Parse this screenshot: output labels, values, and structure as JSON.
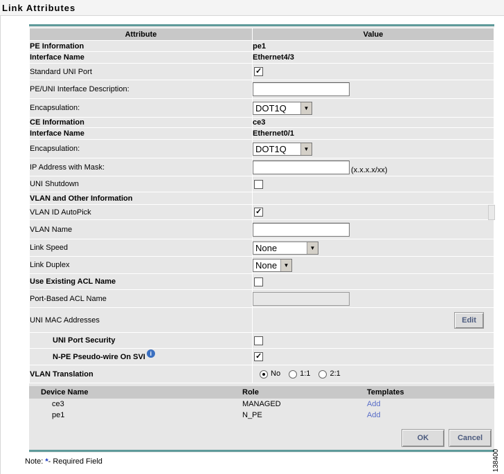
{
  "page": {
    "title": "Link Attributes"
  },
  "table": {
    "col_attribute": "Attribute",
    "col_value": "Value"
  },
  "pe": {
    "section": "PE Information",
    "value": "pe1",
    "interface_name_label": "Interface Name",
    "interface_name": "Ethernet4/3",
    "std_uni_label": "Standard UNI Port",
    "std_uni_checked": true,
    "desc_label": "PE/UNI Interface Description:",
    "desc_value": "",
    "encap_label": "Encapsulation:",
    "encap_value": "DOT1Q"
  },
  "ce": {
    "section": "CE Information",
    "value": "ce3",
    "interface_name_label": "Interface Name",
    "interface_name": "Ethernet0/1",
    "encap_label": "Encapsulation:",
    "encap_value": "DOT1Q",
    "ip_label": "IP Address with Mask:",
    "ip_value": "",
    "ip_hint": "(x.x.x.x/xx)",
    "shutdown_label": "UNI Shutdown",
    "shutdown_checked": false
  },
  "vlan": {
    "section": "VLAN and Other Information",
    "autopick_label": "VLAN ID AutoPick",
    "autopick_checked": true,
    "name_label": "VLAN Name",
    "name_value": "",
    "speed_label": "Link Speed",
    "speed_value": "None",
    "duplex_label": "Link Duplex",
    "duplex_value": "None"
  },
  "acl": {
    "use_label": "Use Existing ACL Name",
    "use_checked": false,
    "port_label": "Port-Based ACL Name",
    "port_value": "",
    "mac_label": "UNI MAC Addresses",
    "edit_label": "Edit",
    "security_label": "UNI Port Security",
    "security_checked": false,
    "pw_label": "N-PE Pseudo-wire On SVI",
    "pw_checked": true,
    "info_icon": "i",
    "translation_label": "VLAN Translation",
    "opt_no": "No",
    "opt_11": "1:1",
    "opt_21": "2:1",
    "translation_value": "No"
  },
  "devices": {
    "col_name": "Device Name",
    "col_role": "Role",
    "col_templates": "Templates",
    "rows": [
      {
        "name": "ce3",
        "role": "MANAGED",
        "templates": "Add"
      },
      {
        "name": "pe1",
        "role": "N_PE",
        "templates": "Add"
      }
    ]
  },
  "buttons": {
    "ok": "OK",
    "cancel": "Cancel"
  },
  "note": {
    "prefix": "Note: ",
    "marker": "*",
    "text": "- Required Field"
  },
  "figure_number": "138400",
  "colors": {
    "rule": "#5f9a9a",
    "header_bg": "#c8c8c8",
    "panel_bg": "#e7e7e7",
    "link": "#5a6ec8"
  }
}
